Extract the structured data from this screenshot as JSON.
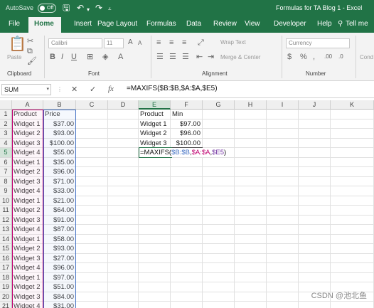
{
  "titlebar": {
    "autosave_label": "AutoSave",
    "autosave_state": "Off",
    "title": "Formulas for TA Blog 1  -  Excel"
  },
  "tabs": [
    "File",
    "Home",
    "Insert",
    "Page Layout",
    "Formulas",
    "Data",
    "Review",
    "View",
    "Developer",
    "Help",
    "Tell me"
  ],
  "ribbon": {
    "paste": "Paste",
    "clipboard": "Clipboard",
    "font_name": "Calibri",
    "font_size": "11",
    "font": "Font",
    "wrap_text": "Wrap Text",
    "merge_center": "Merge & Center",
    "alignment": "Alignment",
    "number_format": "Currency",
    "number": "Number",
    "cond": "Cond"
  },
  "formula_bar": {
    "name_box": "SUM",
    "cancel": "✕",
    "enter": "✓",
    "fx": "fx",
    "formula": "=MAXIFS($B:$B,$A:$A,$E5)"
  },
  "columns": [
    "A",
    "B",
    "C",
    "D",
    "E",
    "F",
    "G",
    "H",
    "I",
    "J",
    "K"
  ],
  "rows": [
    {
      "n": "1",
      "a": "Product",
      "b": "Price",
      "e": "Product",
      "f": "Min"
    },
    {
      "n": "2",
      "a": "Widget 1",
      "b": "$37.00",
      "e": "Widget 1",
      "f": "$97.00"
    },
    {
      "n": "3",
      "a": "Widget 2",
      "b": "$93.00",
      "e": "Widget 2",
      "f": "$96.00"
    },
    {
      "n": "4",
      "a": "Widget 3",
      "b": "$100.00",
      "e": "Widget 3",
      "f": "$100.00"
    },
    {
      "n": "5",
      "a": "Widget 4",
      "b": "$55.00",
      "e": "",
      "f": ""
    },
    {
      "n": "6",
      "a": "Widget 1",
      "b": "$35.00",
      "e": "",
      "f": ""
    },
    {
      "n": "7",
      "a": "Widget 2",
      "b": "$96.00",
      "e": "",
      "f": ""
    },
    {
      "n": "8",
      "a": "Widget 3",
      "b": "$71.00",
      "e": "",
      "f": ""
    },
    {
      "n": "9",
      "a": "Widget 4",
      "b": "$33.00",
      "e": "",
      "f": ""
    },
    {
      "n": "10",
      "a": "Widget 1",
      "b": "$21.00",
      "e": "",
      "f": ""
    },
    {
      "n": "11",
      "a": "Widget 2",
      "b": "$64.00",
      "e": "",
      "f": ""
    },
    {
      "n": "12",
      "a": "Widget 3",
      "b": "$91.00",
      "e": "",
      "f": ""
    },
    {
      "n": "13",
      "a": "Widget 4",
      "b": "$87.00",
      "e": "",
      "f": ""
    },
    {
      "n": "14",
      "a": "Widget 1",
      "b": "$58.00",
      "e": "",
      "f": ""
    },
    {
      "n": "15",
      "a": "Widget 2",
      "b": "$93.00",
      "e": "",
      "f": ""
    },
    {
      "n": "16",
      "a": "Widget 3",
      "b": "$27.00",
      "e": "",
      "f": ""
    },
    {
      "n": "17",
      "a": "Widget 4",
      "b": "$96.00",
      "e": "",
      "f": ""
    },
    {
      "n": "18",
      "a": "Widget 1",
      "b": "$97.00",
      "e": "",
      "f": ""
    },
    {
      "n": "19",
      "a": "Widget 2",
      "b": "$51.00",
      "e": "",
      "f": ""
    },
    {
      "n": "20",
      "a": "Widget 3",
      "b": "$84.00",
      "e": "",
      "f": ""
    },
    {
      "n": "21",
      "a": "Widget 4",
      "b": "$31.00",
      "e": "",
      "f": ""
    }
  ],
  "edit_cell": {
    "prefix": "=MAXIFS(",
    "arg1": "$B:$B",
    "sep1": ",",
    "arg2": "$A:$A",
    "sep2": ",",
    "arg3": "$E5",
    "suffix": ")"
  },
  "colors": {
    "excel_green": "#217346",
    "range_a": "#c00070",
    "range_b": "#4472c4",
    "range_e": "#7030a0"
  },
  "watermark": "CSDN @池北鱼"
}
